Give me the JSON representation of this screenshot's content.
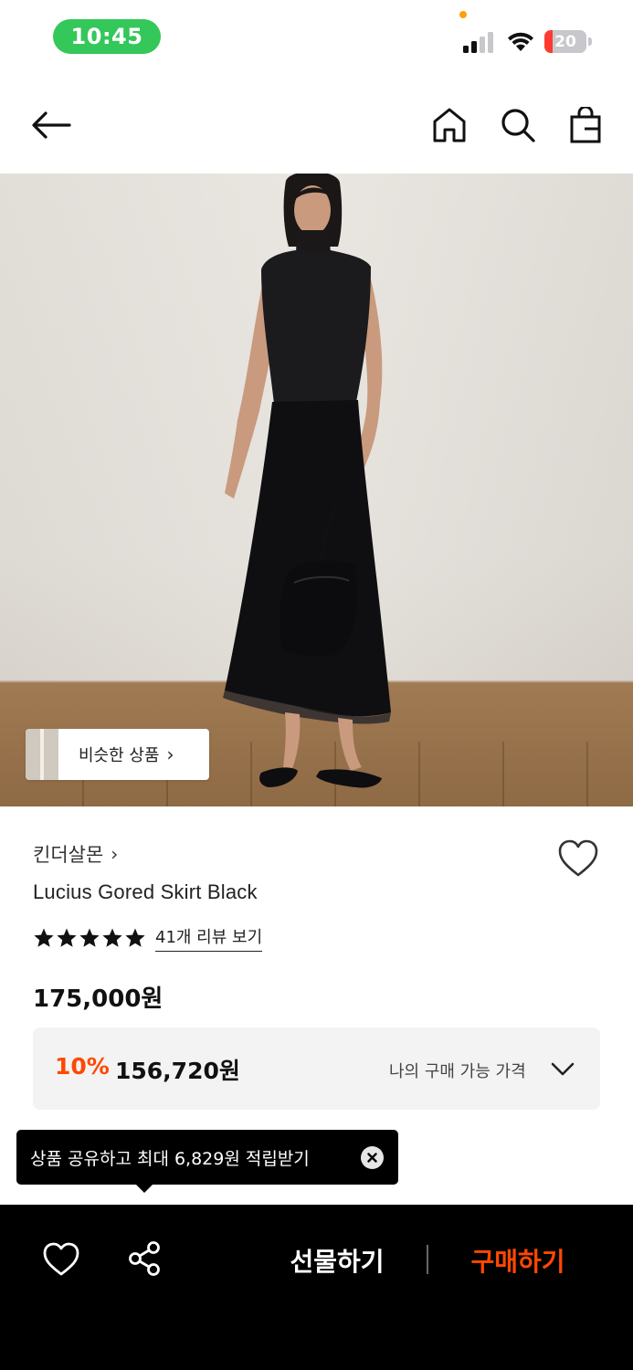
{
  "status_bar": {
    "time": "10:45",
    "battery": "20",
    "battery_level_percent": 20
  },
  "nav": {
    "back_icon": "arrow-left-icon",
    "home_icon": "home-icon",
    "search_icon": "search-icon",
    "cart_icon": "shopping-bag-icon"
  },
  "hero": {
    "similar_label": "비슷한 상품",
    "similar_chevron": "›"
  },
  "product": {
    "brand": "킨더살몬",
    "brand_chevron": "›",
    "name": "Lucius Gored Skirt Black",
    "rating_stars": 5,
    "review_link": "41개 리뷰 보기",
    "price": "175,000원",
    "discount_rate": "10%",
    "discount_price": "156,720원",
    "discount_label": "나의 구매 가능 가격"
  },
  "tooltip": {
    "text": "상품 공유하고 최대 6,829원 적립받기"
  },
  "bottom_bar": {
    "gift_label": "선물하기",
    "buy_label": "구매하기"
  },
  "colors": {
    "accent": "#ff4800",
    "status_time_bg": "#34c759",
    "bottom_bar_bg": "#000000"
  }
}
